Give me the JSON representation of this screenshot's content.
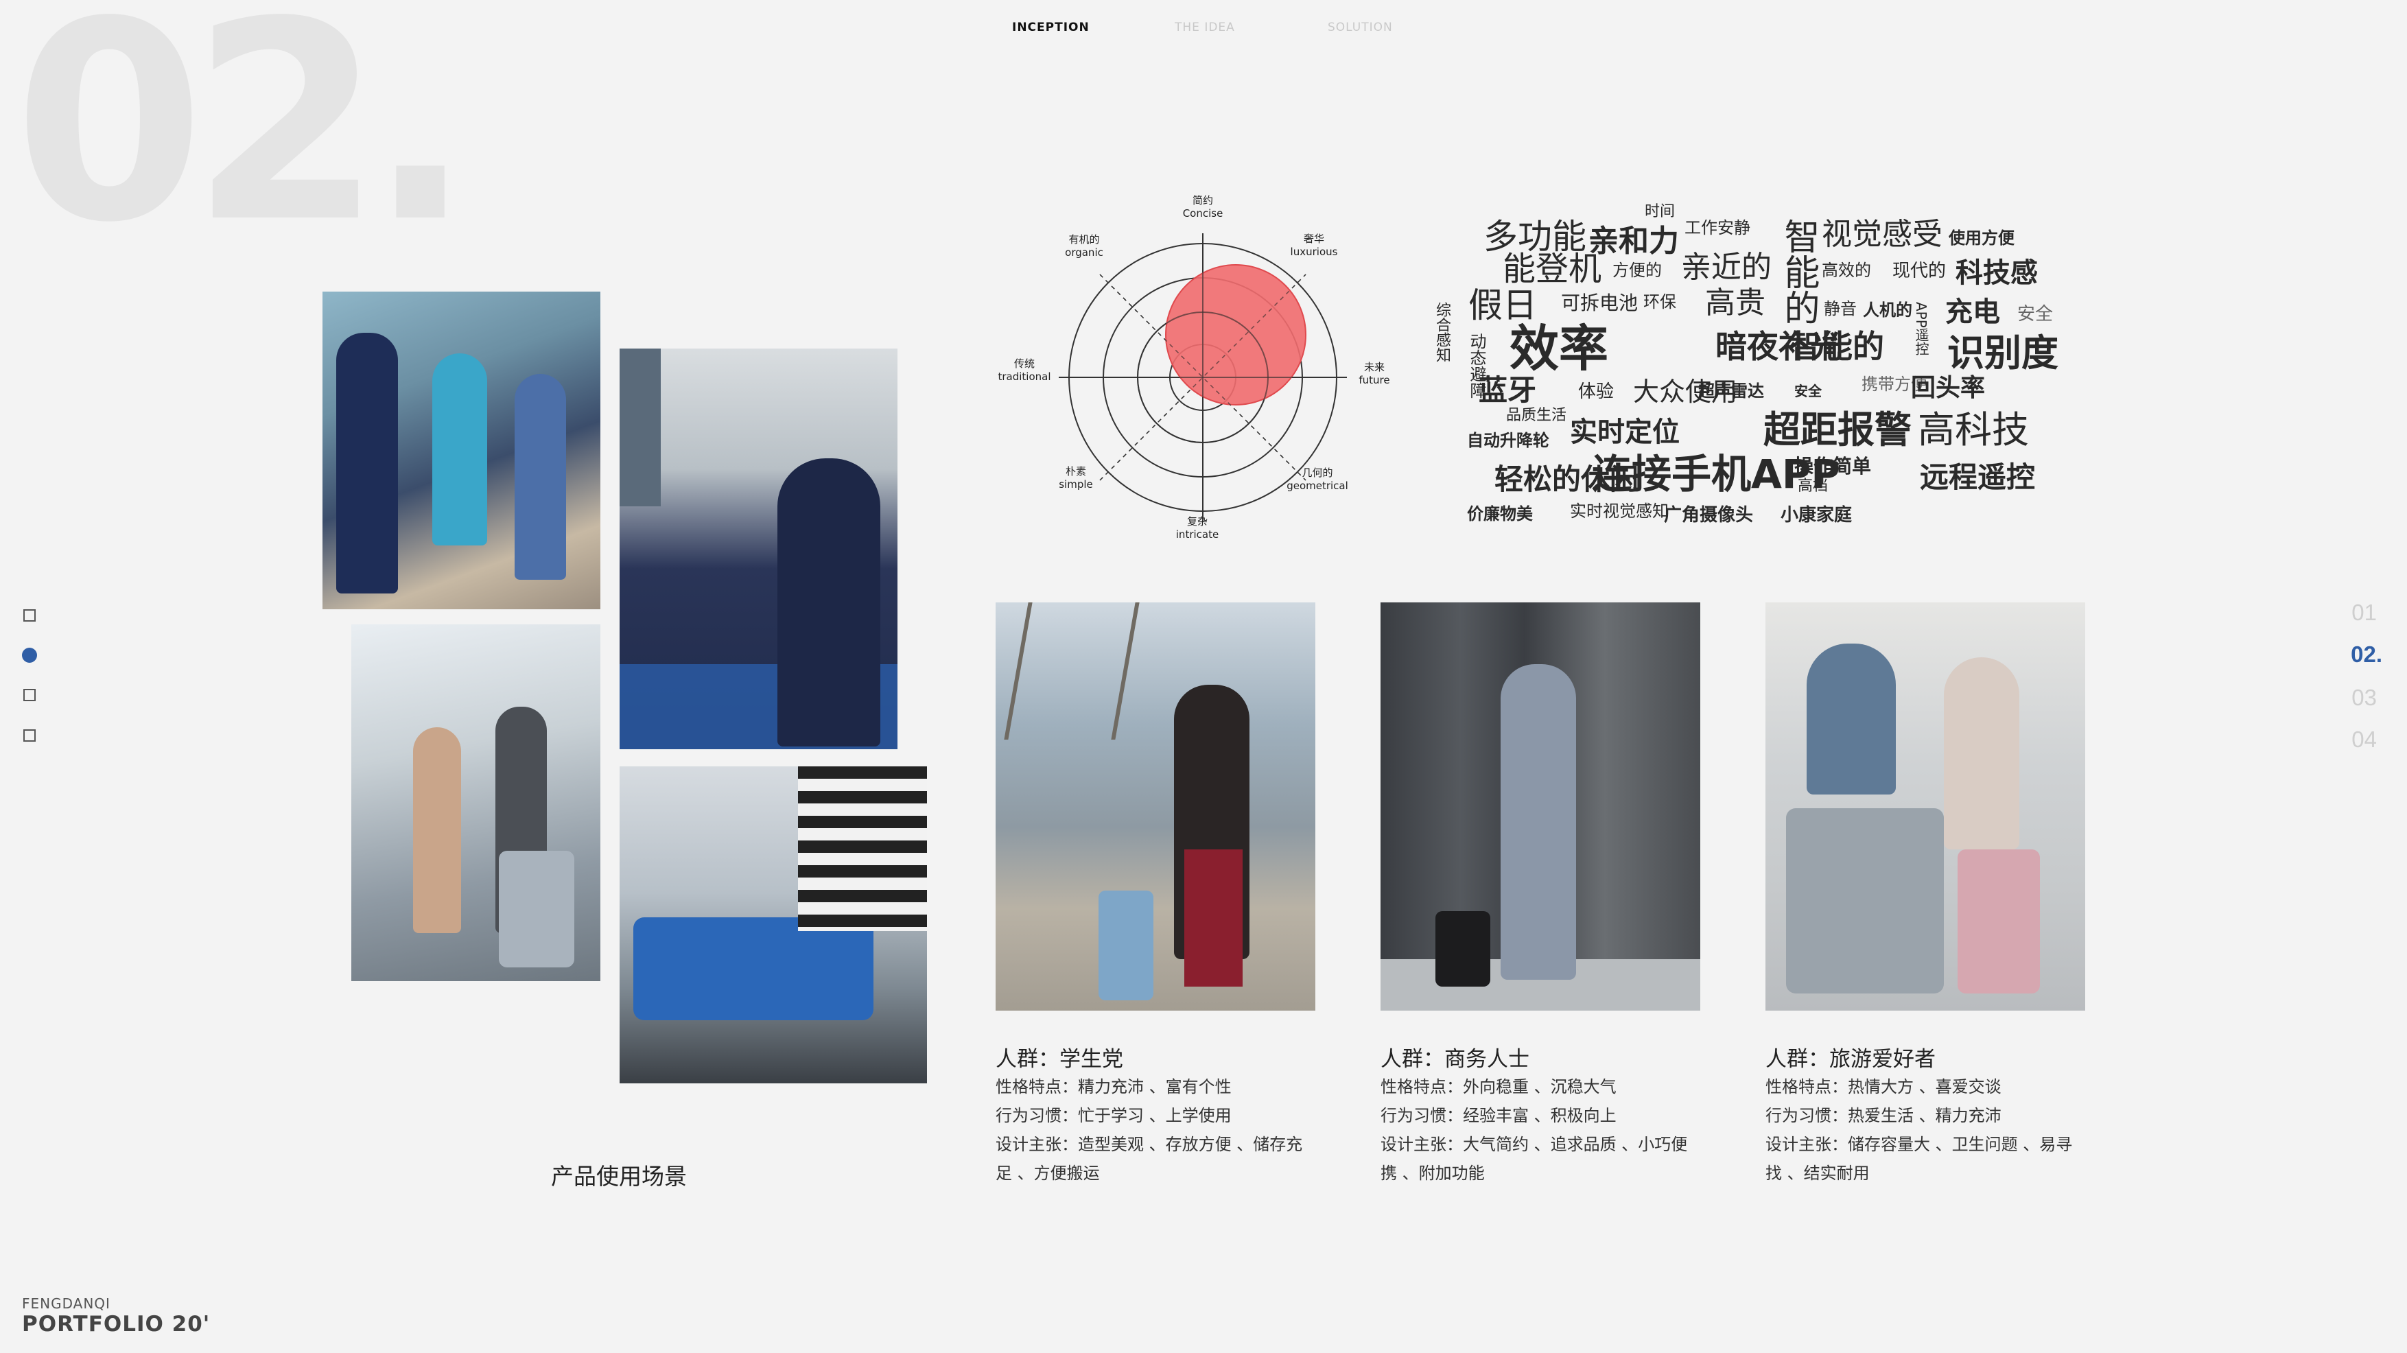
{
  "page_number": "02.",
  "topnav": {
    "items": [
      "INCEPTION",
      "THE IDEA",
      "SOLUTION"
    ],
    "active": "INCEPTION"
  },
  "side_nav": {
    "items": [
      "01",
      "02.",
      "03",
      "04"
    ],
    "active": "02."
  },
  "footer": {
    "author": "FENGDANQI",
    "portfolio": "PORTFOLIO 20'"
  },
  "scene_caption": "产品使用场景",
  "photos": [
    "travelers-walking-photo",
    "overhead-bin-photo",
    "stairs-luggage-photo",
    "conveyor-suitcase-photo"
  ],
  "radar": {
    "labels": [
      {
        "cn": "简约",
        "en": "Concise"
      },
      {
        "cn": "奢华",
        "en": "luxurious"
      },
      {
        "cn": "未来",
        "en": "future"
      },
      {
        "cn": "几何的",
        "en": "geometrical"
      },
      {
        "cn": "复杂",
        "en": "intricate"
      },
      {
        "cn": "朴素",
        "en": "simple"
      },
      {
        "cn": "传统",
        "en": "traditional"
      },
      {
        "cn": "有机的",
        "en": "organic"
      }
    ],
    "accent": "#f16b6e"
  },
  "word_cloud": [
    "时间",
    "多功能",
    "亲和力",
    "工作安静",
    "能登机",
    "方便的",
    "亲近的",
    "智能的",
    "视觉感受",
    "使用方便",
    "高效的",
    "现代的",
    "科技感",
    "综合感知",
    "假日",
    "可拆电池",
    "环保",
    "高贵",
    "静音",
    "人机的",
    "APP遥控",
    "充电",
    "安全",
    "动态避障",
    "效率",
    "暗夜补光",
    "智能的",
    "识别度",
    "蓝牙",
    "体验",
    "大众使用",
    "超声雷达",
    "安全",
    "携带方便",
    "回头率",
    "品质生活",
    "自动升降轮",
    "实时定位",
    "超距报警",
    "高科技",
    "轻松的休闲",
    "连接手机APP",
    "操作简单",
    "高档",
    "远程遥控",
    "价廉物美",
    "实时视觉感知",
    "广角摄像头",
    "小康家庭"
  ],
  "personas": [
    {
      "title": "人群：学生党",
      "traits": "性格特点：精力充沛 、富有个性",
      "habits": "行为习惯：忙于学习 、上学使用",
      "design1": "设计主张：造型美观 、存放方便 、储存充",
      "design2": "足 、方便搬运",
      "photo": "student-eiffel-photo"
    },
    {
      "title": "人群：商务人士",
      "traits": "性格特点：外向稳重 、沉稳大气",
      "habits": "行为习惯：经验丰富 、积极向上",
      "design1": "设计主张：大气简约 、追求品质 、小巧便",
      "design2": "携 、附加功能",
      "photo": "businessman-photo"
    },
    {
      "title": "人群：旅游爱好者",
      "traits": "性格特点：热情大方 、喜爱交谈",
      "habits": "行为习惯：热爱生活 、精力充沛",
      "design1": "设计主张：储存容量大 、卫生问题 、易寻",
      "design2": "找 、结实耐用",
      "photo": "family-travel-photo"
    }
  ]
}
